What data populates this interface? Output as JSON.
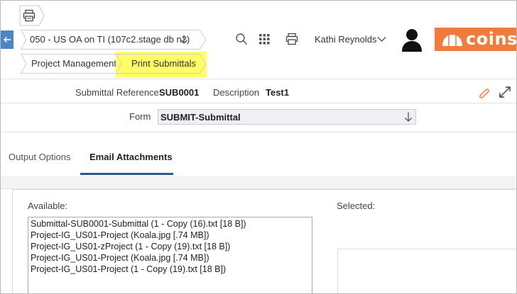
{
  "breadcrumb": {
    "project_selector": "050 - US OA on TI (107c2.stage db n2)",
    "crumb_1": "Project Management",
    "crumb_2": "Print Submittals"
  },
  "header": {
    "user_name": "Kathi Reynolds",
    "logo_text": "coins"
  },
  "record": {
    "submittal_reference_label": "Submittal Reference",
    "submittal_reference_value": "SUB0001",
    "description_label": "Description",
    "description_value": "Test1",
    "form_label": "Form",
    "form_value": "SUBMIT-Submittal"
  },
  "tabs": [
    {
      "label": "Output Options",
      "active": false
    },
    {
      "label": "Email Attachments",
      "active": true
    }
  ],
  "attachments": {
    "available_label": "Available:",
    "selected_label": "Selected:",
    "available_items": [
      "Submittal-SUB0001-Submittal (1 - Copy (16).txt [18 B])",
      "Project-IG_US01-Project (Koala.jpg [.74 MB])",
      "Project-IG_US01-zProject (1 - Copy (19).txt [18 B])",
      "Project-IG_US01-Project (Koala.jpg [.74 MB])",
      "Project-IG_US01-Project (1 - Copy (19).txt [18 B])"
    ]
  },
  "colors": {
    "highlight": "#ffff66",
    "accent": "#f07b3c",
    "back_button": "#4a86c5",
    "tab_underline": "#2c5a8c"
  },
  "icons": [
    "printer-icon",
    "back-arrow-icon",
    "search-icon",
    "apps-grid-icon",
    "printer-icon",
    "chevron-down-icon",
    "user-avatar-icon",
    "attachment-tag-icon",
    "expand-icon"
  ]
}
